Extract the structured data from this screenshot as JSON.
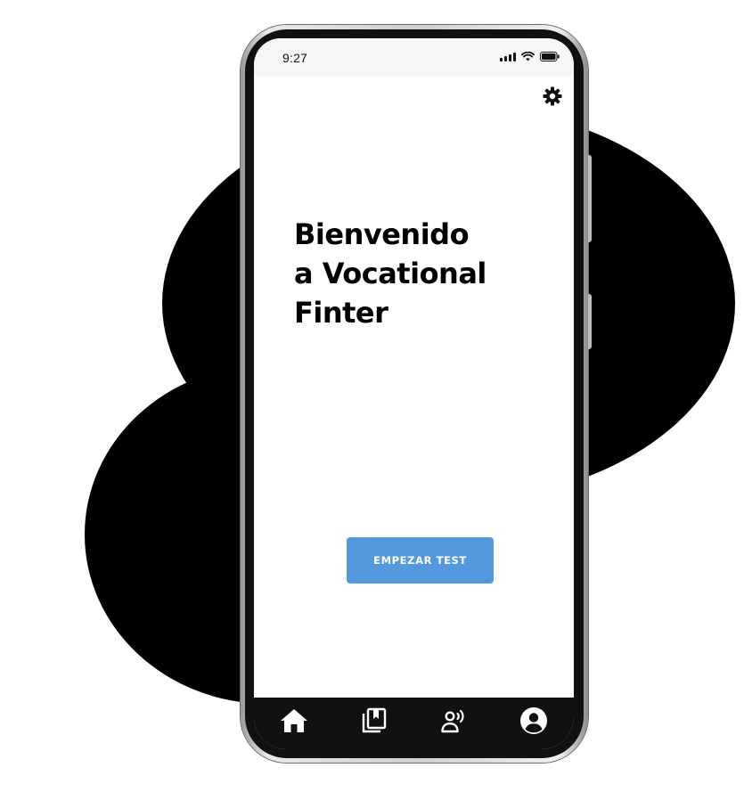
{
  "status_bar": {
    "time": "9:27",
    "icons": [
      "signal-icon",
      "wifi-icon",
      "battery-icon"
    ]
  },
  "header": {
    "settings_icon": "gear-icon"
  },
  "main": {
    "title_lines": [
      "Bienvenido",
      "a Vocational",
      "Finter"
    ],
    "start_button_label": "EMPEZAR TEST",
    "accent_color": "#5499dd"
  },
  "bottom_nav": {
    "items": [
      {
        "icon": "home-icon"
      },
      {
        "icon": "library-bookmark-icon"
      },
      {
        "icon": "speaking-person-icon"
      },
      {
        "icon": "account-icon"
      }
    ]
  }
}
